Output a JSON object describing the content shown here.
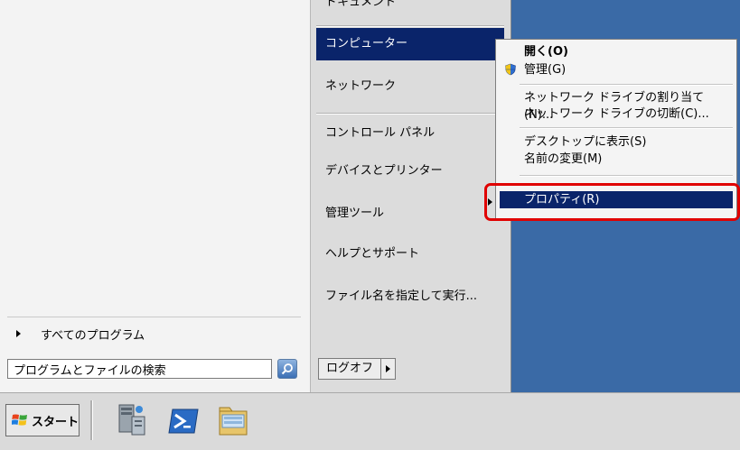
{
  "start_menu": {
    "left": {
      "all_programs": "すべてのプログラム",
      "search_placeholder": "プログラムとファイルの検索"
    },
    "right": {
      "top_item": "ドキュメント",
      "items": [
        {
          "label": "コンピューター",
          "selected": true
        },
        {
          "label": "ネットワーク"
        },
        {
          "label": "コントロール パネル"
        },
        {
          "label": "デバイスとプリンター"
        },
        {
          "label": "管理ツール"
        },
        {
          "label": "ヘルプとサポート"
        },
        {
          "label": "ファイル名を指定して実行..."
        }
      ],
      "logoff": "ログオフ"
    }
  },
  "context_menu": {
    "items": [
      {
        "label": "開く(O)"
      },
      {
        "label": "管理(G)"
      },
      {
        "label": "ネットワーク ドライブの割り当て(N)..."
      },
      {
        "label": "ネットワーク ドライブの切断(C)..."
      },
      {
        "label": "デスクトップに表示(S)"
      },
      {
        "label": "名前の変更(M)"
      },
      {
        "label": "プロパティ(R)",
        "selected": true
      }
    ]
  },
  "taskbar": {
    "start_label": "スタート",
    "pinned": [
      "server-manager-icon",
      "powershell-icon",
      "file-explorer-icon"
    ]
  },
  "colors": {
    "selection": "#0a246a",
    "highlight_box": "#e00000",
    "desktop": "#3a6aa6"
  }
}
